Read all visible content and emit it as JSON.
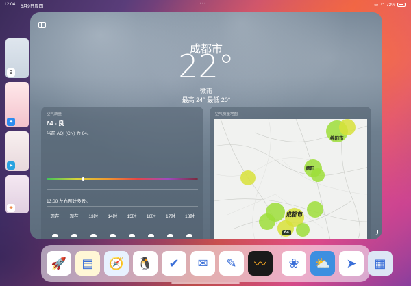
{
  "status_bar": {
    "time": "12:04",
    "date": "6月9日周四",
    "battery": "72%",
    "center_dots": "•••"
  },
  "weather": {
    "city": "成都市",
    "temperature": "22°",
    "condition": "微雨",
    "high_low": "最高 24°  最低 20°"
  },
  "aqi": {
    "header": "空气质量",
    "value": "64 - 良",
    "description": "当前 AQI (CN) 为 64。",
    "marker_fraction": 0.24,
    "forecast_text": "13:00 左右预计多云。",
    "hours": [
      "现在",
      "现在",
      "13时",
      "14时",
      "15时",
      "16时",
      "17时",
      "18时"
    ],
    "hour_icons": [
      "cloud-icon",
      "cloud-icon",
      "cloud-icon",
      "cloud-icon",
      "cloud-icon",
      "cloud-icon",
      "cloud-icon",
      "cloud-icon"
    ]
  },
  "map": {
    "header": "空气质量地图",
    "labels": {
      "luoyang": "绵阳市",
      "deyang": "德阳",
      "chengdu": "成都市"
    },
    "badge": "64"
  },
  "side_badges": {
    "calendar_day": "9"
  },
  "dock_apps": [
    {
      "name": "shadowrocket",
      "glyph": "🚀",
      "bg": "#ffffff"
    },
    {
      "name": "notes",
      "glyph": "▤",
      "bg": "#fff7d6"
    },
    {
      "name": "safari",
      "glyph": "🧭",
      "bg": "#e8f2ff"
    },
    {
      "name": "qq",
      "glyph": "🐧",
      "bg": "#ffffff"
    },
    {
      "name": "omnifocus",
      "glyph": "✔",
      "bg": "#ffffff"
    },
    {
      "name": "mail-app",
      "glyph": "✉",
      "bg": "#ffffff"
    },
    {
      "name": "goodnotes",
      "glyph": "✎",
      "bg": "#ffffff"
    },
    {
      "name": "procreate",
      "glyph": "〰",
      "bg": "#1a1a1a"
    },
    {
      "name": "photos",
      "glyph": "❀",
      "bg": "#ffffff"
    },
    {
      "name": "weather",
      "glyph": "⛅",
      "bg": "#3d8fe0"
    },
    {
      "name": "telegram",
      "glyph": "➤",
      "bg": "#ffffff"
    },
    {
      "name": "app-library",
      "glyph": "▦",
      "bg": "#dde6f5"
    }
  ]
}
